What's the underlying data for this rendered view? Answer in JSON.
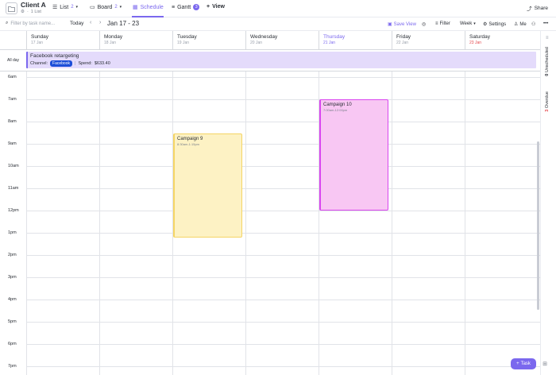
{
  "project": {
    "title": "Client A",
    "sub": "1 List"
  },
  "views": {
    "list": {
      "label": "List",
      "count": "2"
    },
    "board": {
      "label": "Board",
      "count": "2"
    },
    "schedule": {
      "label": "Schedule"
    },
    "gantt": {
      "label": "Gantt",
      "count": "3"
    },
    "add_view": "View"
  },
  "share_label": "Share",
  "toolbar": {
    "search_placeholder": "Filter by task name...",
    "today": "Today",
    "range": "Jan 17 - 23",
    "save_view": "Save View",
    "filter": "Filter",
    "week": "Week",
    "settings": "Settings",
    "me": "Me"
  },
  "days": [
    {
      "name": "Sunday",
      "date": "17 Jan"
    },
    {
      "name": "Monday",
      "date": "18 Jan"
    },
    {
      "name": "Tuesday",
      "date": "19 Jan"
    },
    {
      "name": "Wednesday",
      "date": "20 Jan"
    },
    {
      "name": "Thursday",
      "date": "21 Jan"
    },
    {
      "name": "Friday",
      "date": "22 Jan"
    },
    {
      "name": "Saturday",
      "date": "23 Jan"
    }
  ],
  "allday": {
    "label": "All day",
    "event": {
      "title": "Facebook retargeting",
      "channel_label": "Channel:",
      "channel_value": "Facebook",
      "spend_label": "Spend:",
      "spend_value": "$633.40"
    }
  },
  "hours": [
    "6am",
    "7am",
    "8am",
    "9am",
    "10am",
    "11am",
    "12pm",
    "1pm",
    "2pm",
    "3pm",
    "4pm",
    "5pm",
    "6pm",
    "7pm"
  ],
  "events": {
    "campaign9": {
      "title": "Campaign 9",
      "time": "8:30am-1:15pm",
      "color": "#fdf2c4",
      "border": "#f5d565"
    },
    "campaign10": {
      "title": "Campaign 10",
      "time": "7:00am-12:00pm",
      "color": "#f8c7f3",
      "border": "#d946ef"
    }
  },
  "rail": {
    "unscheduled_count": "0",
    "unscheduled_label": "Unscheduled",
    "overdue_count": "3",
    "overdue_label": "Overdue"
  },
  "task_button": "Task",
  "colors": {
    "accent": "#7b68ee",
    "facebook_pill": "#1d4ed8",
    "overdue": "#e5484d"
  }
}
